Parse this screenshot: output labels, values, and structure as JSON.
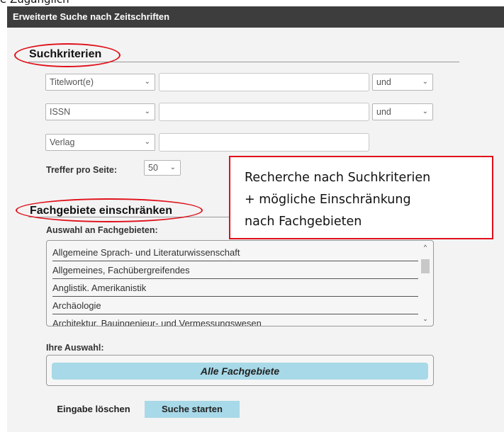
{
  "top_text": "e Zugänglich",
  "header": {
    "title": "Erweiterte Suche nach Zeitschriften"
  },
  "search_criteria": {
    "title": "Suchkriterien",
    "rows": [
      {
        "field": "Titelwort(e)",
        "value": "",
        "operator": "und"
      },
      {
        "field": "ISSN",
        "value": "",
        "operator": "und"
      },
      {
        "field": "Verlag",
        "value": ""
      }
    ],
    "hits_label": "Treffer pro Seite:",
    "hits_value": "50"
  },
  "callout": {
    "line1": "Recherche nach Suchkriterien",
    "line2": "+ mögliche Einschränkung",
    "line3": "nach Fachgebieten"
  },
  "subject_filter": {
    "title": "Fachgebiete einschränken",
    "list_label": "Auswahl an Fachgebieten:",
    "items": [
      "Allgemeine Sprach- und Literaturwissenschaft",
      "Allgemeines, Fachübergreifendes",
      "Anglistik. Amerikanistik",
      "Archäologie",
      "Architektur, Bauingenieur- und Vermessungswesen"
    ],
    "selection_label": "Ihre Auswahl:",
    "selection_value": "Alle Fachgebiete"
  },
  "actions": {
    "clear_label": "Eingabe löschen",
    "search_label": "Suche starten"
  },
  "colors": {
    "header_bg": "#3d3d3d",
    "panel_bg": "#f3f3f3",
    "annotation_red": "#e0101a",
    "accent_blue": "#a8d9e8"
  },
  "icons": {
    "dropdown": "chevron-down-icon",
    "scroll_up": "chevron-up-icon",
    "scroll_down": "chevron-down-icon"
  }
}
